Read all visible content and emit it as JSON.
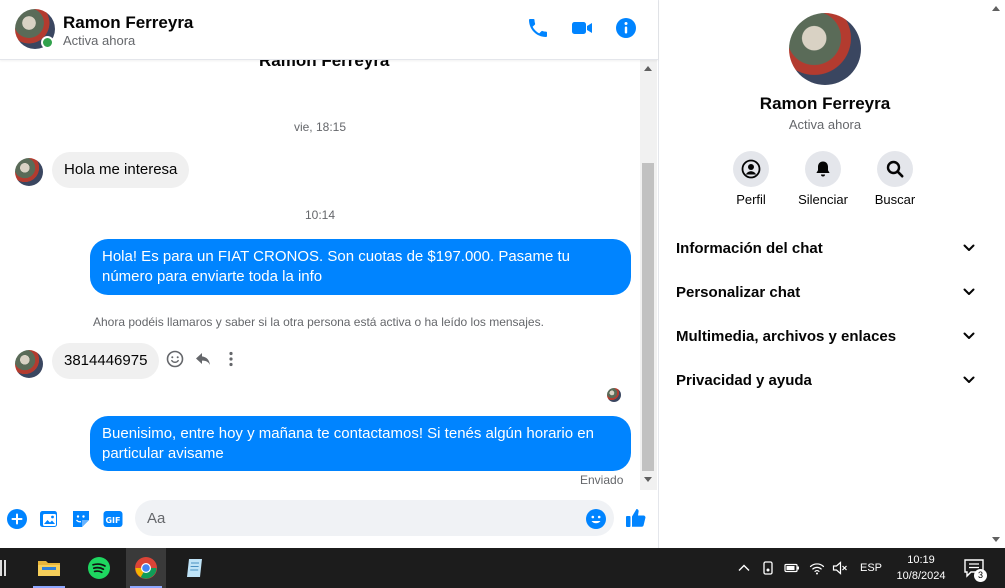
{
  "header": {
    "name": "Ramon Ferreyra",
    "status": "Activa ahora"
  },
  "conversation": {
    "top_name": "Ramon Ferreyra",
    "timestamps": [
      "vie, 18:15",
      "10:14"
    ],
    "messages": [
      {
        "direction": "incoming",
        "text": "Hola me interesa"
      },
      {
        "direction": "outgoing",
        "text": "Hola! Es para un FIAT CRONOS. Son cuotas de $197.000. Pasame tu número para enviarte toda la info"
      },
      {
        "direction": "incoming",
        "text": "3814446975"
      },
      {
        "direction": "outgoing",
        "text": "Buenisimo, entre hoy y mañana te contactamos! Si tenés algún horario en particular avisame"
      }
    ],
    "notice": "Ahora podéis llamaros y saber si la otra persona está activa o ha leído los mensajes.",
    "sent_label": "Enviado"
  },
  "composer": {
    "placeholder": "Aa"
  },
  "info": {
    "name": "Ramon Ferreyra",
    "status": "Activa ahora",
    "actions": [
      {
        "label": "Perfil",
        "icon": "profile-icon"
      },
      {
        "label": "Silenciar",
        "icon": "bell-icon"
      },
      {
        "label": "Buscar",
        "icon": "search-icon"
      }
    ],
    "sections": [
      "Información del chat",
      "Personalizar chat",
      "Multimedia, archivos y enlaces",
      "Privacidad y ayuda"
    ]
  },
  "taskbar": {
    "language": "ESP",
    "time": "10:19",
    "date": "10/8/2024",
    "notification_count": "3"
  },
  "colors": {
    "accent": "#0084ff",
    "online": "#31a24c",
    "incoming_bubble": "#f0f0f0"
  }
}
